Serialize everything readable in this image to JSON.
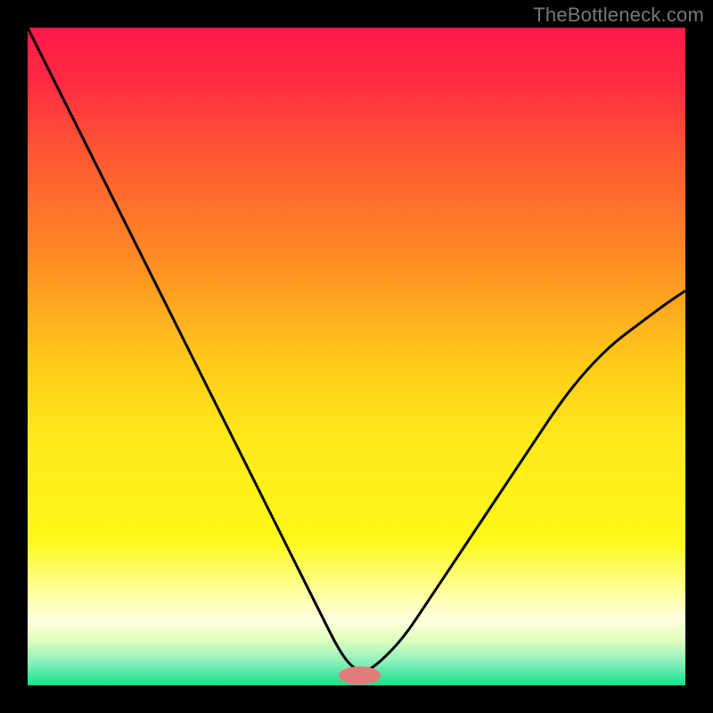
{
  "watermark": "TheBottleneck.com",
  "chart_data": {
    "type": "line",
    "title": "",
    "xlabel": "",
    "ylabel": "",
    "xlim": [
      0,
      100
    ],
    "ylim": [
      0,
      100
    ],
    "grid": false,
    "background_gradient": {
      "stops": [
        {
          "offset": 0.0,
          "color": "#ff1a4b"
        },
        {
          "offset": 0.08,
          "color": "#ff2a42"
        },
        {
          "offset": 0.2,
          "color": "#ff5a33"
        },
        {
          "offset": 0.35,
          "color": "#ff8a24"
        },
        {
          "offset": 0.5,
          "color": "#ffc81a"
        },
        {
          "offset": 0.62,
          "color": "#ffe81a"
        },
        {
          "offset": 0.78,
          "color": "#fff81a"
        },
        {
          "offset": 0.86,
          "color": "#ffffa0"
        },
        {
          "offset": 0.9,
          "color": "#ffffe0"
        },
        {
          "offset": 0.93,
          "color": "#e0ffc0"
        },
        {
          "offset": 0.965,
          "color": "#8af0bb"
        },
        {
          "offset": 1.0,
          "color": "#14e08a"
        }
      ]
    },
    "series": [
      {
        "name": "bottleneck-curve",
        "stroke": "#000000",
        "stroke_width": 3,
        "x": [
          0,
          3,
          7,
          11,
          15,
          19,
          23,
          27,
          31,
          35,
          39,
          43,
          45,
          47,
          49,
          51,
          53,
          57,
          61,
          65,
          69,
          73,
          77,
          81,
          85,
          89,
          93,
          97,
          100
        ],
        "values": [
          100,
          94,
          86,
          78,
          70,
          62,
          54,
          46,
          38,
          30,
          22,
          14,
          10,
          6,
          3,
          2,
          3,
          7,
          13,
          19,
          25,
          31,
          37,
          43,
          48,
          52,
          55,
          58,
          60
        ]
      }
    ],
    "marker": {
      "name": "optimal-point",
      "x": 50.5,
      "y": 1.5,
      "rx": 3.2,
      "ry": 1.4,
      "fill": "#e27b7b"
    }
  }
}
